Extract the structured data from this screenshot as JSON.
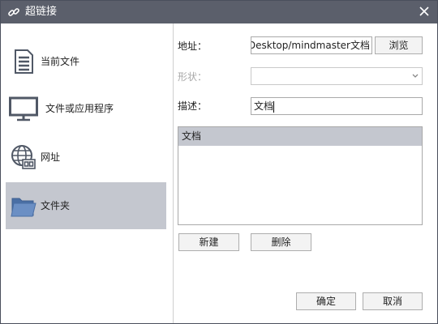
{
  "window": {
    "title": "超链接"
  },
  "sidebar": {
    "items": [
      {
        "label": "当前文件"
      },
      {
        "label": "文件或应用程序"
      },
      {
        "label": "网址"
      },
      {
        "label": "文件夹"
      }
    ]
  },
  "form": {
    "address_label": "地址：",
    "address_value": "Desktop/mindmaster文档",
    "browse_label": "浏览",
    "shape_label": "形状：",
    "shape_value": "",
    "description_label": "描述：",
    "description_value": "文档"
  },
  "list": {
    "items": [
      "文档"
    ]
  },
  "actions": {
    "new_label": "新建",
    "delete_label": "删除"
  },
  "footer": {
    "ok_label": "确定",
    "cancel_label": "取消"
  },
  "colors": {
    "titlebar": "#5b5f6b",
    "selection": "#c4c7cf",
    "folder_icon": "#5b7fb0"
  }
}
